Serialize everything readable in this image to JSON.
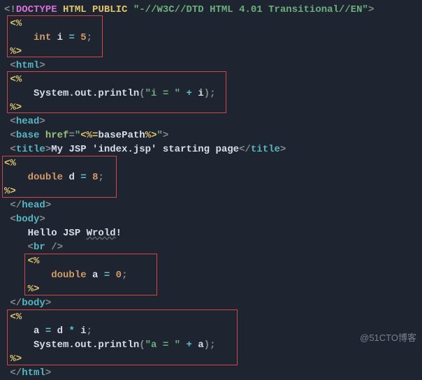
{
  "doctype": {
    "open": "<!",
    "kw1": "DOCTYPE",
    "kw2": "HTML",
    "kw3": "PUBLIC",
    "str": "\"-//W3C//DTD HTML 4.01 Transitional//EN\"",
    "close": ">"
  },
  "jsp_open": "<%",
  "jsp_close": "%>",
  "scriptlet1": {
    "type": "int",
    "ident": "i",
    "eq": "=",
    "val": "5",
    "semi": ";"
  },
  "scriptlet2": {
    "call_obj": "System.out.println",
    "lparen": "(",
    "str": "\"i = \"",
    "plus": "+",
    "var": "i",
    "rparen": ")",
    "semi": ";"
  },
  "scriptlet3": {
    "type": "double",
    "ident": "d",
    "eq": "=",
    "val": "8",
    "semi": ";"
  },
  "scriptlet4": {
    "type": "double",
    "ident": "a",
    "eq": "=",
    "val": "0",
    "semi": ";"
  },
  "scriptlet5": {
    "line1": {
      "lhs": "a",
      "eq": "=",
      "r1": "d",
      "op": "*",
      "r2": "i",
      "semi": ";"
    },
    "line2": {
      "call_obj": "System.out.println",
      "lparen": "(",
      "str": "\"a = \"",
      "plus": "+",
      "var": "a",
      "rparen": ")",
      "semi": ";"
    }
  },
  "tags": {
    "lt": "<",
    "gt": ">",
    "lt_close": "</",
    "html": "html",
    "head": "head",
    "base": "base",
    "title": "title",
    "body": "body",
    "br": "br",
    "slash_gt": "/>"
  },
  "base_attr": {
    "name": "href",
    "eq": "=",
    "q": "\"",
    "jsp_expr_open": "<%=",
    "expr": "basePath",
    "jsp_expr_close": "%>"
  },
  "title_text": "My JSP 'index.jsp' starting page",
  "body_text": {
    "pre": "Hello JSP ",
    "wrold": "Wrold",
    "post": "!"
  },
  "watermark": "@51CTO博客"
}
